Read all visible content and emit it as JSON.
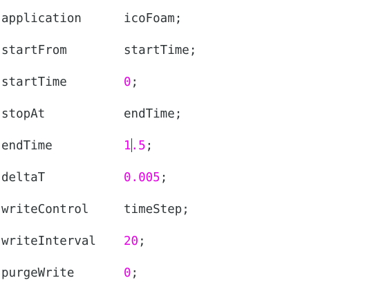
{
  "editor": {
    "lines": [
      {
        "key": "application",
        "value": "icoFoam",
        "type": "word",
        "terminator": ";"
      },
      {
        "key": "startFrom",
        "value": "startTime",
        "type": "word",
        "terminator": ";"
      },
      {
        "key": "startTime",
        "value": "0",
        "type": "number",
        "terminator": ";"
      },
      {
        "key": "stopAt",
        "value": "endTime",
        "type": "word",
        "terminator": ";"
      },
      {
        "key": "endTime",
        "value_before_cursor": "1",
        "value_after_cursor": ".5",
        "type": "number",
        "terminator": ";"
      },
      {
        "key": "deltaT",
        "value": "0.005",
        "type": "number",
        "terminator": ";"
      },
      {
        "key": "writeControl",
        "value": "timeStep",
        "type": "word",
        "terminator": ";"
      },
      {
        "key": "writeInterval",
        "value": "20",
        "type": "number",
        "terminator": ";"
      },
      {
        "key": "purgeWrite",
        "value": "0",
        "type": "number",
        "terminator": ";"
      }
    ]
  },
  "colors": {
    "text": "#2e3436",
    "number": "#e500e5",
    "background": "#ffffff"
  }
}
